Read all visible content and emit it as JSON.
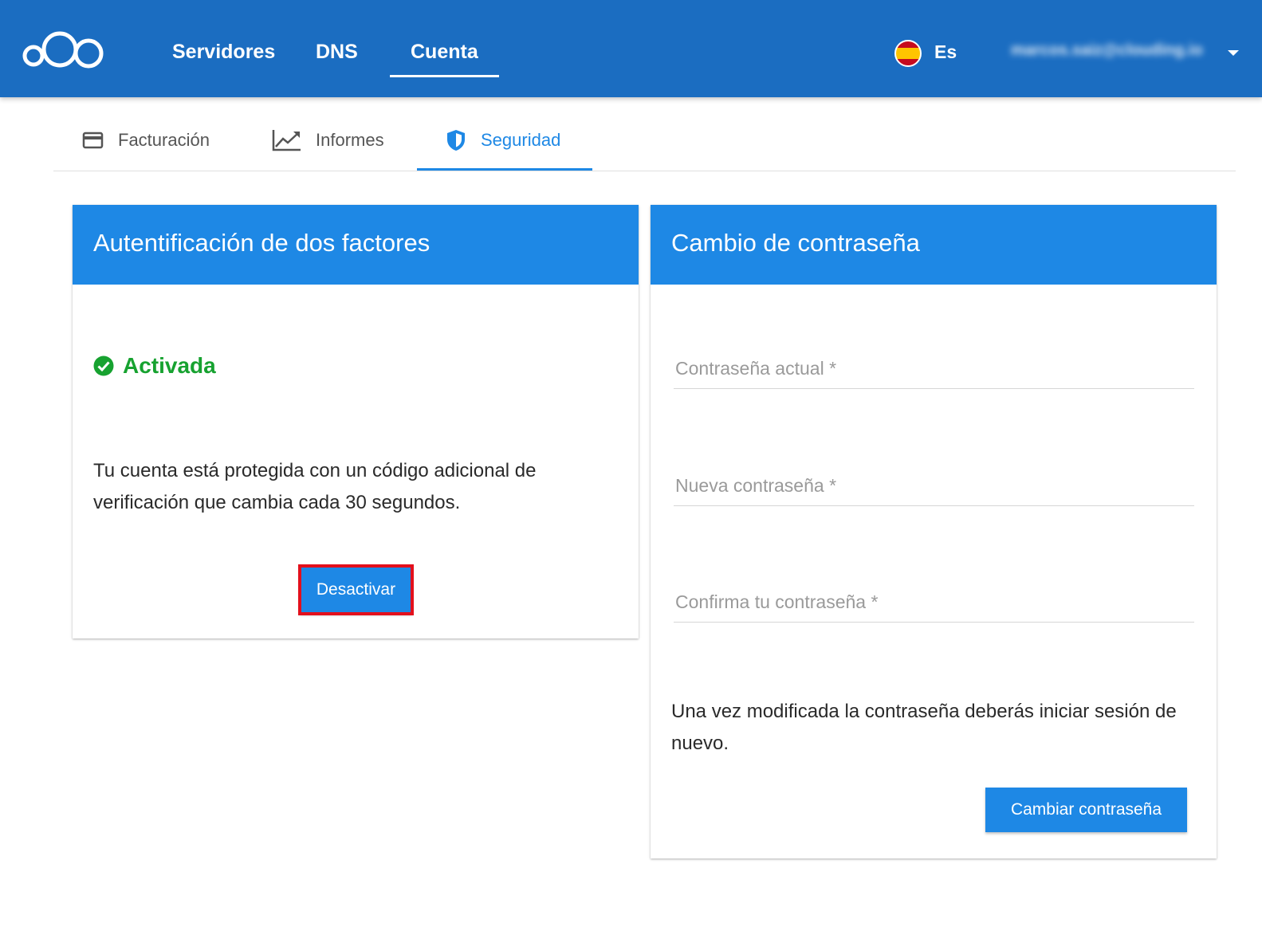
{
  "header": {
    "nav": [
      {
        "label": "Servidores"
      },
      {
        "label": "DNS"
      },
      {
        "label": "Cuenta"
      }
    ],
    "language": "Es",
    "user_email": "marcos.saiz@clouding.io"
  },
  "tabs": [
    {
      "label": "Facturación",
      "icon": "credit-card-icon"
    },
    {
      "label": "Informes",
      "icon": "chart-line-icon"
    },
    {
      "label": "Seguridad",
      "icon": "shield-icon",
      "active": true
    }
  ],
  "two_factor": {
    "title": "Autentificación de dos factores",
    "status": "Activada",
    "description": "Tu cuenta está protegida con un código adicional de verificación que cambia cada 30 segundos.",
    "deactivate_label": "Desactivar"
  },
  "password_change": {
    "title": "Cambio de contraseña",
    "fields": [
      {
        "label": "Contraseña actual *"
      },
      {
        "label": "Nueva contraseña *"
      },
      {
        "label": "Confirma tu contraseña *"
      }
    ],
    "note": "Una vez modificada la contraseña deberás iniciar sesión de nuevo.",
    "submit_label": "Cambiar contraseña"
  },
  "colors": {
    "header_bg": "#1b6dc1",
    "accent": "#1e88e5",
    "success": "#17a230",
    "highlight": "#e3101c"
  }
}
